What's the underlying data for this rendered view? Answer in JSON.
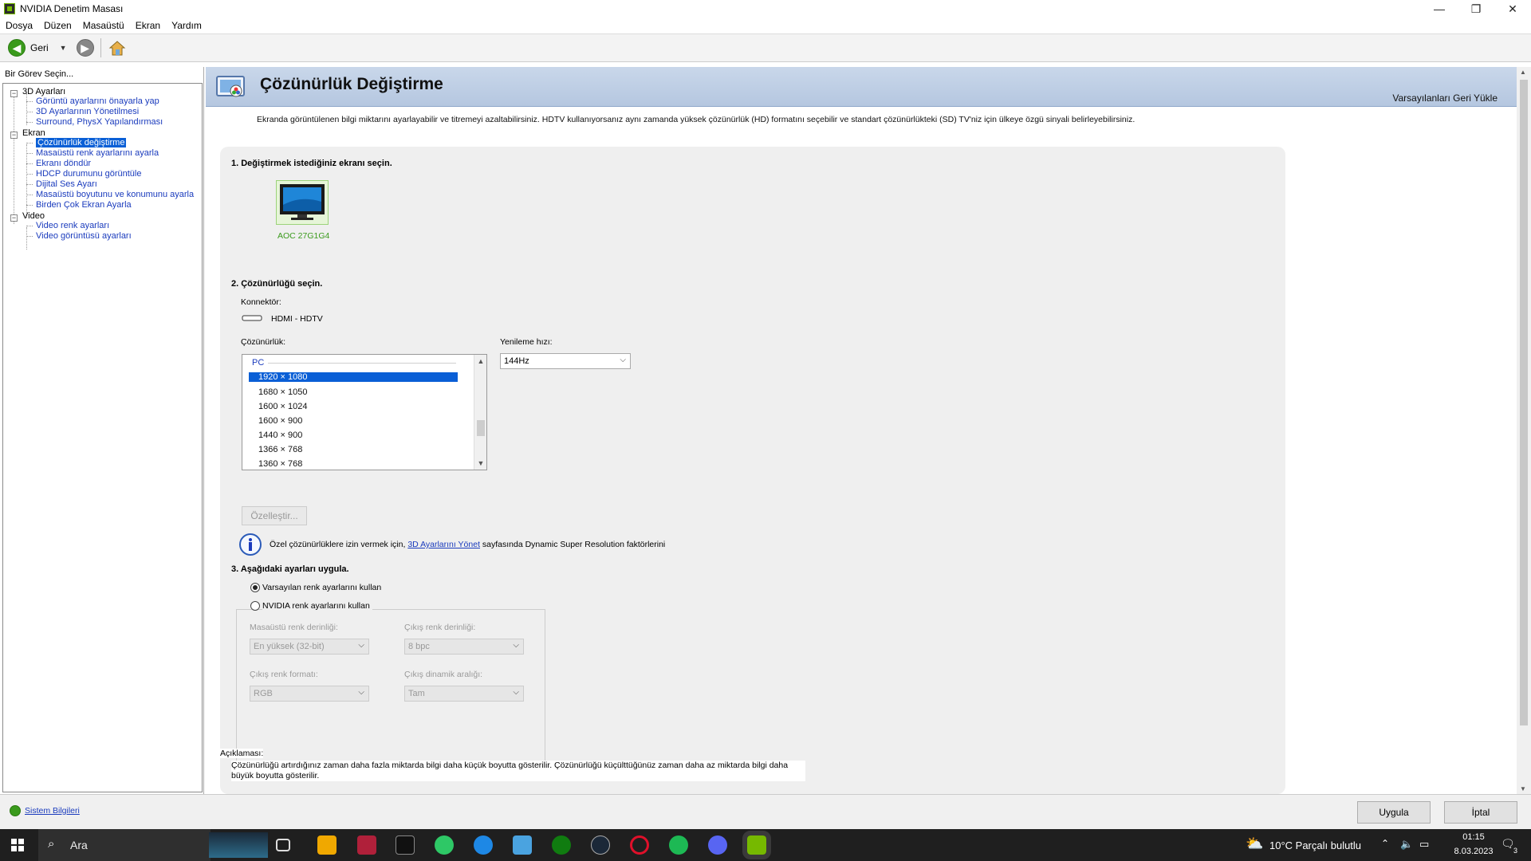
{
  "window": {
    "title": "NVIDIA Denetim Masası",
    "minimize": "—",
    "maximize": "❐",
    "close": "✕"
  },
  "menu": [
    "Dosya",
    "Düzen",
    "Masaüstü",
    "Ekran",
    "Yardım"
  ],
  "toolbar": {
    "back_label": "Geri"
  },
  "left": {
    "header": "Bir Görev Seçin...",
    "tree": [
      {
        "label": "3D Ayarları",
        "type": "cat"
      },
      {
        "label": "Görüntü ayarlarını önayarla yap",
        "type": "leaf"
      },
      {
        "label": "3D Ayarlarının Yönetilmesi",
        "type": "leaf"
      },
      {
        "label": "Surround, PhysX Yapılandırması",
        "type": "leaf"
      },
      {
        "label": "Ekran",
        "type": "cat"
      },
      {
        "label": "Çözünürlük değiştirme",
        "type": "leaf"
      },
      {
        "label": "Masaüstü renk ayarlarını ayarla",
        "type": "leaf"
      },
      {
        "label": "Ekranı döndür",
        "type": "leaf"
      },
      {
        "label": "HDCP durumunu görüntüle",
        "type": "leaf"
      },
      {
        "label": "Dijital Ses Ayarı",
        "type": "leaf"
      },
      {
        "label": "Masaüstü boyutunu ve konumunu ayarla",
        "type": "leaf"
      },
      {
        "label": "Birden Çok Ekran Ayarla",
        "type": "leaf"
      },
      {
        "label": "Video",
        "type": "cat"
      },
      {
        "label": "Video renk ayarları",
        "type": "leaf"
      },
      {
        "label": "Video görüntüsü ayarları",
        "type": "leaf"
      }
    ],
    "selected": "Çözünürlük değiştirme",
    "system_info": "Sistem Bilgileri"
  },
  "main": {
    "title": "Çözünürlük Değiştirme",
    "restore_defaults": "Varsayılanları Geri Yükle",
    "description": "Ekranda görüntülenen bilgi miktarını ayarlayabilir ve titremeyi azaltabilirsiniz. HDTV kullanıyorsanız aynı zamanda yüksek çözünürlük (HD) formatını seçebilir ve standart çözünürlükteki (SD) TV'niz için ülkeye özgü sinyali belirleyebilirsiniz.",
    "step1": "1. Değiştirmek istediğiniz ekranı seçin.",
    "monitor_name": "AOC 27G1G4",
    "step2": "2. Çözünürlüğü seçin.",
    "connector_label": "Konnektör:",
    "connector_value": "HDMI - HDTV",
    "resolution_label": "Çözünürlük:",
    "refresh_label": "Yenileme hızı:",
    "refresh_value": "144Hz",
    "res_group": "PC",
    "resolutions": [
      "1920 × 1080",
      "1680 × 1050",
      "1600 × 1024",
      "1600 × 900",
      "1440 × 900",
      "1366 × 768",
      "1360 × 768"
    ],
    "selected_resolution": "1920 × 1080",
    "customize": "Özelleştir...",
    "info_pre": "Özel çözünürlüklere izin vermek için, ",
    "info_link": "3D Ayarlarını Yönet",
    "info_post": " sayfasında Dynamic Super Resolution faktörlerini",
    "step3": "3. Aşağıdaki ayarları uygula.",
    "radio_default": "Varsayılan renk ayarlarını kullan",
    "radio_nvidia": "NVIDIA renk ayarlarını kullan",
    "desktop_depth_label": "Masaüstü renk derinliği:",
    "desktop_depth_value": "En yüksek (32-bit)",
    "output_depth_label": "Çıkış renk derinliği:",
    "output_depth_value": "8 bpc",
    "output_format_label": "Çıkış renk formatı:",
    "output_format_value": "RGB",
    "dynamic_range_label": "Çıkış dinamik aralığı:",
    "dynamic_range_value": "Tam",
    "explain_label": "Açıklaması:",
    "explain_text": "Çözünürlüğü artırdığınız zaman daha fazla miktarda bilgi daha küçük boyutta gösterilir. Çözünürlüğü küçülttüğünüz zaman daha az miktarda bilgi daha büyük boyutta gösterilir."
  },
  "buttons": {
    "apply": "Uygula",
    "cancel": "İptal"
  },
  "taskbar": {
    "search": "Ara",
    "weather": "10°C  Parçalı bulutlu",
    "time": "01:15",
    "date": "8.03.2023",
    "notif": "3"
  }
}
